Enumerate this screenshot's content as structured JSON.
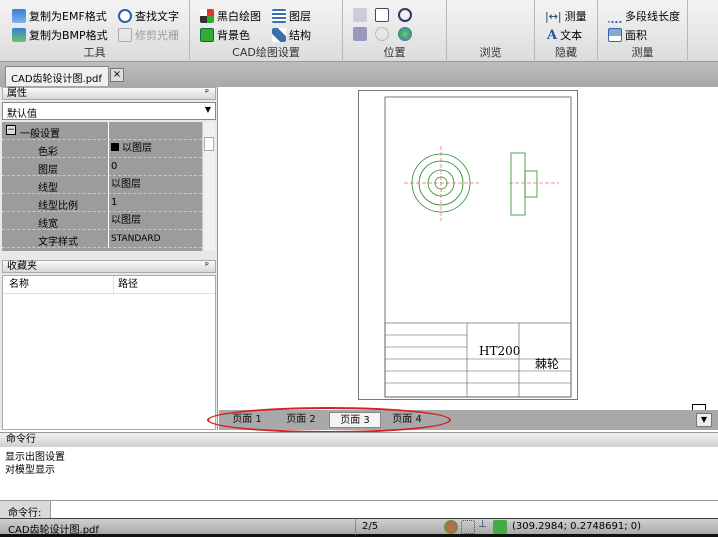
{
  "ribbon": {
    "groups": [
      {
        "label": "工具",
        "items": [
          "复制为EMF格式",
          "复制为BMP格式",
          "查找文字",
          "修剪光栅"
        ]
      },
      {
        "label": "CAD绘图设置",
        "items": [
          "黑白绘图",
          "背景色",
          "图层",
          "结构"
        ]
      },
      {
        "label": "位置"
      },
      {
        "label": "浏览"
      },
      {
        "label": "隐藏",
        "items": [
          "测量",
          "文本"
        ]
      },
      {
        "label": "测量",
        "items": [
          "多段线长度",
          "面积"
        ]
      }
    ]
  },
  "document_tab": {
    "title": "CAD齿轮设计图.pdf",
    "close": "×"
  },
  "properties": {
    "title": "属性",
    "pin": "ᵖ",
    "dropdown": "默认值",
    "section": "一般设置",
    "rows": [
      {
        "k": "色彩",
        "v": "以图层"
      },
      {
        "k": "图层",
        "v": "0"
      },
      {
        "k": "线型",
        "v": "以图层"
      },
      {
        "k": "线型比例",
        "v": "1"
      },
      {
        "k": "线宽",
        "v": "以图层"
      },
      {
        "k": "文字样式",
        "v": "STANDARD"
      }
    ]
  },
  "favorites": {
    "title": "收藏夹",
    "col_name": "名称",
    "col_path": "路径"
  },
  "drawing": {
    "material": "HT200",
    "part": "棘轮"
  },
  "page_tabs": [
    "页面 1",
    "页面 2",
    "页面 3",
    "页面 4"
  ],
  "command": {
    "title": "命令行",
    "output": [
      "显示出图设置",
      "对模型显示"
    ],
    "prompt": "命令行:"
  },
  "status": {
    "file": "CAD齿轮设计图.pdf",
    "page": "2/5",
    "coords": "(309.2984; 0.2748691; 0)"
  }
}
